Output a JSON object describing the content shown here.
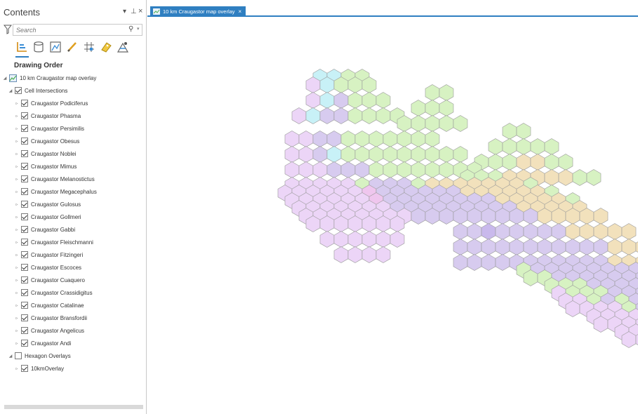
{
  "contents_pane": {
    "title": "Contents",
    "search_placeholder": "Search",
    "drawing_order_label": "Drawing Order",
    "map_name": "10 km Craugastor map overlay",
    "groups": [
      {
        "label": "Cell Intersections",
        "checked": true,
        "layers": [
          "Craugastor Podiciferus",
          "Craugastor Phasma",
          "Craugastor Persimilis",
          "Craugastor Obesus",
          "Craugastor Noblei",
          "Craugastor Mimus",
          "Craugastor Melanostictus",
          "Craugastor Megacephalus",
          "Craugastor Gulosus",
          "Craugastor Gollmeri",
          "Craugastor Gabbi",
          "Craugastor Fleischmanni",
          "Craugastor Fitzingeri",
          "Craugastor Escoces",
          "Craugastor Cuaquero",
          "Craugastor Crassidigitus",
          "Craugastor Catalinae",
          "Craugastor Bransfordii",
          "Craugastor Angelicus",
          "Craugastor Andi"
        ]
      },
      {
        "label": "Hexagon Overlays",
        "checked": false,
        "layers": [
          "10kmOverlay"
        ]
      }
    ],
    "toolbar_icons": [
      "list-by-drawing-order-icon",
      "list-by-data-source-icon",
      "list-by-selection-icon",
      "list-by-editing-icon",
      "list-by-snapping-icon",
      "list-by-labeling-icon",
      "list-by-perspective-imagery-icon"
    ]
  },
  "map_tab": {
    "label": "10 km Craugastor map overlay",
    "close_glyph": "×"
  },
  "hex_colors": {
    "p": "#ecd5f7",
    "v": "#d7cbef",
    "V": "#c9b9ec",
    "g": "#d7f2c2",
    "o": "#f2e1bc",
    "c": "#c8f1f7",
    "m": "#efc6ee"
  },
  "hex_grid_rows": [
    [
      "3",
      "ccgg"
    ],
    [
      "2",
      "pcggg"
    ],
    [
      "11",
      "gg"
    ],
    [
      "2",
      "pcvggg"
    ],
    [
      "10",
      "ggg"
    ],
    [
      "1",
      "pcvvgggg"
    ],
    [
      "9",
      "ggggg"
    ],
    [
      "16",
      "gg"
    ],
    [
      "1",
      "ppvvggggggg"
    ],
    [
      "15",
      "ggggg"
    ],
    [
      "1",
      "ppvcggggggggg"
    ],
    [
      "14",
      "gggoogg"
    ],
    [
      "1",
      "pppvvvgggggggg"
    ],
    [
      "13",
      "gggooooogg"
    ],
    [
      "1",
      "pppppgvvvgooooooog"
    ],
    [
      "0",
      "ppppppmvvvvvvoooooog"
    ],
    [
      "1",
      "ppppppmvvvvvvvvooooog"
    ],
    [
      "1",
      "pppppppvvvvvvvvvooooo"
    ],
    [
      "2",
      "ppppppppvvvvvvvvvooooo"
    ],
    [
      "2",
      "ppppppp"
    ],
    [
      "13",
      "vvVvvvvvooooo"
    ],
    [
      "3",
      "pppppp"
    ],
    [
      "13",
      "vvvvvvvvvvvooo"
    ],
    [
      "4",
      "pppp"
    ],
    [
      "13",
      "vvvvvvvvvvvooooo"
    ],
    [
      "17",
      "gvvvvvvvvvvvvoooo"
    ],
    [
      "18",
      "ggvvvvvvvvvvvoooog"
    ],
    [
      "19",
      "gggvvvvvvvvvvvvoo"
    ],
    [
      "20",
      "pgggvvvvvvvvvvv"
    ],
    [
      "20",
      "ppgvgvvvvvvvvv"
    ],
    [
      "21",
      "ppppgvvvvvvv"
    ],
    [
      "22",
      "pppppppvvvv"
    ],
    [
      "23",
      "ppppppppp"
    ],
    [
      "24",
      "ppppppp"
    ],
    [
      "25",
      "ppppp"
    ],
    [
      "26",
      "ppp"
    ],
    [
      "27",
      "p"
    ]
  ]
}
